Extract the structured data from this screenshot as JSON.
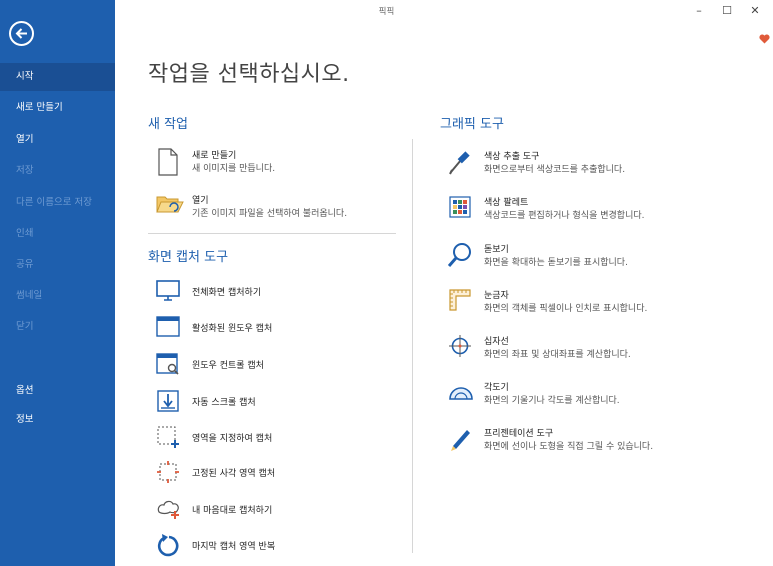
{
  "app": {
    "title": "픽픽"
  },
  "window": {
    "minimize": "–",
    "maximize": "☐",
    "close": "✕"
  },
  "colors": {
    "sidebar": "#1e5fae",
    "accent": "#1e5fae",
    "heart": "#e05a3a"
  },
  "sidebar": {
    "items": [
      {
        "label": "시작",
        "state": "active"
      },
      {
        "label": "새로 만들기",
        "state": "normal"
      },
      {
        "label": "열기",
        "state": "normal"
      },
      {
        "label": "저장",
        "state": "disabled"
      },
      {
        "label": "다른 이름으로 저장",
        "state": "disabled"
      },
      {
        "label": "인쇄",
        "state": "disabled"
      },
      {
        "label": "공유",
        "state": "disabled"
      },
      {
        "label": "썸네일",
        "state": "disabled"
      },
      {
        "label": "닫기",
        "state": "disabled"
      },
      {
        "label": "옵션",
        "state": "normal"
      },
      {
        "label": "정보",
        "state": "normal"
      }
    ]
  },
  "main": {
    "heading": "작업을 선택하십시오.",
    "new_task": {
      "title": "새 작업",
      "items": [
        {
          "title": "새로 만들기",
          "desc": "새 이미지를 만듭니다.",
          "icon": "new-document-icon"
        },
        {
          "title": "열기",
          "desc": "기존 이미지 파일을 선택하여 불러옵니다.",
          "icon": "open-folder-icon"
        }
      ]
    },
    "capture": {
      "title": "화면 캡처 도구",
      "items": [
        {
          "label": "전체화면 캡처하기",
          "icon": "fullscreen-capture-icon"
        },
        {
          "label": "활성화된 윈도우 캡처",
          "icon": "active-window-capture-icon"
        },
        {
          "label": "윈도우 컨트롤 캡처",
          "icon": "window-control-capture-icon"
        },
        {
          "label": "자동 스크롤 캡처",
          "icon": "scroll-capture-icon"
        },
        {
          "label": "영역을 지정하여 캡처",
          "icon": "region-capture-icon"
        },
        {
          "label": "고정된 사각 영역 캡처",
          "icon": "fixed-region-capture-icon"
        },
        {
          "label": "내 마음대로 캡처하기",
          "icon": "freehand-capture-icon"
        },
        {
          "label": "마지막 캡처 영역 반복",
          "icon": "repeat-capture-icon"
        }
      ]
    },
    "graphics": {
      "title": "그래픽 도구",
      "items": [
        {
          "title": "색상 추출 도구",
          "desc": "화면으로부터 색상코드를 추출합니다.",
          "icon": "eyedropper-icon"
        },
        {
          "title": "색상 팔레트",
          "desc": "색상코드를 편집하거나 형식을 변경합니다.",
          "icon": "palette-icon"
        },
        {
          "title": "돋보기",
          "desc": "화면을 확대하는 돋보기를 표시합니다.",
          "icon": "magnifier-icon"
        },
        {
          "title": "눈금자",
          "desc": "화면의 객체를 픽셀이나 인치로 표시합니다.",
          "icon": "ruler-icon"
        },
        {
          "title": "십자선",
          "desc": "화면의 좌표 및 상대좌표를 계산합니다.",
          "icon": "crosshair-icon"
        },
        {
          "title": "각도기",
          "desc": "화면의 기울기나 각도를 계산합니다.",
          "icon": "protractor-icon"
        },
        {
          "title": "프리젠테이션 도구",
          "desc": "화면에 선이나 도형을 직접 그릴 수 있습니다.",
          "icon": "presentation-pen-icon"
        }
      ]
    }
  }
}
